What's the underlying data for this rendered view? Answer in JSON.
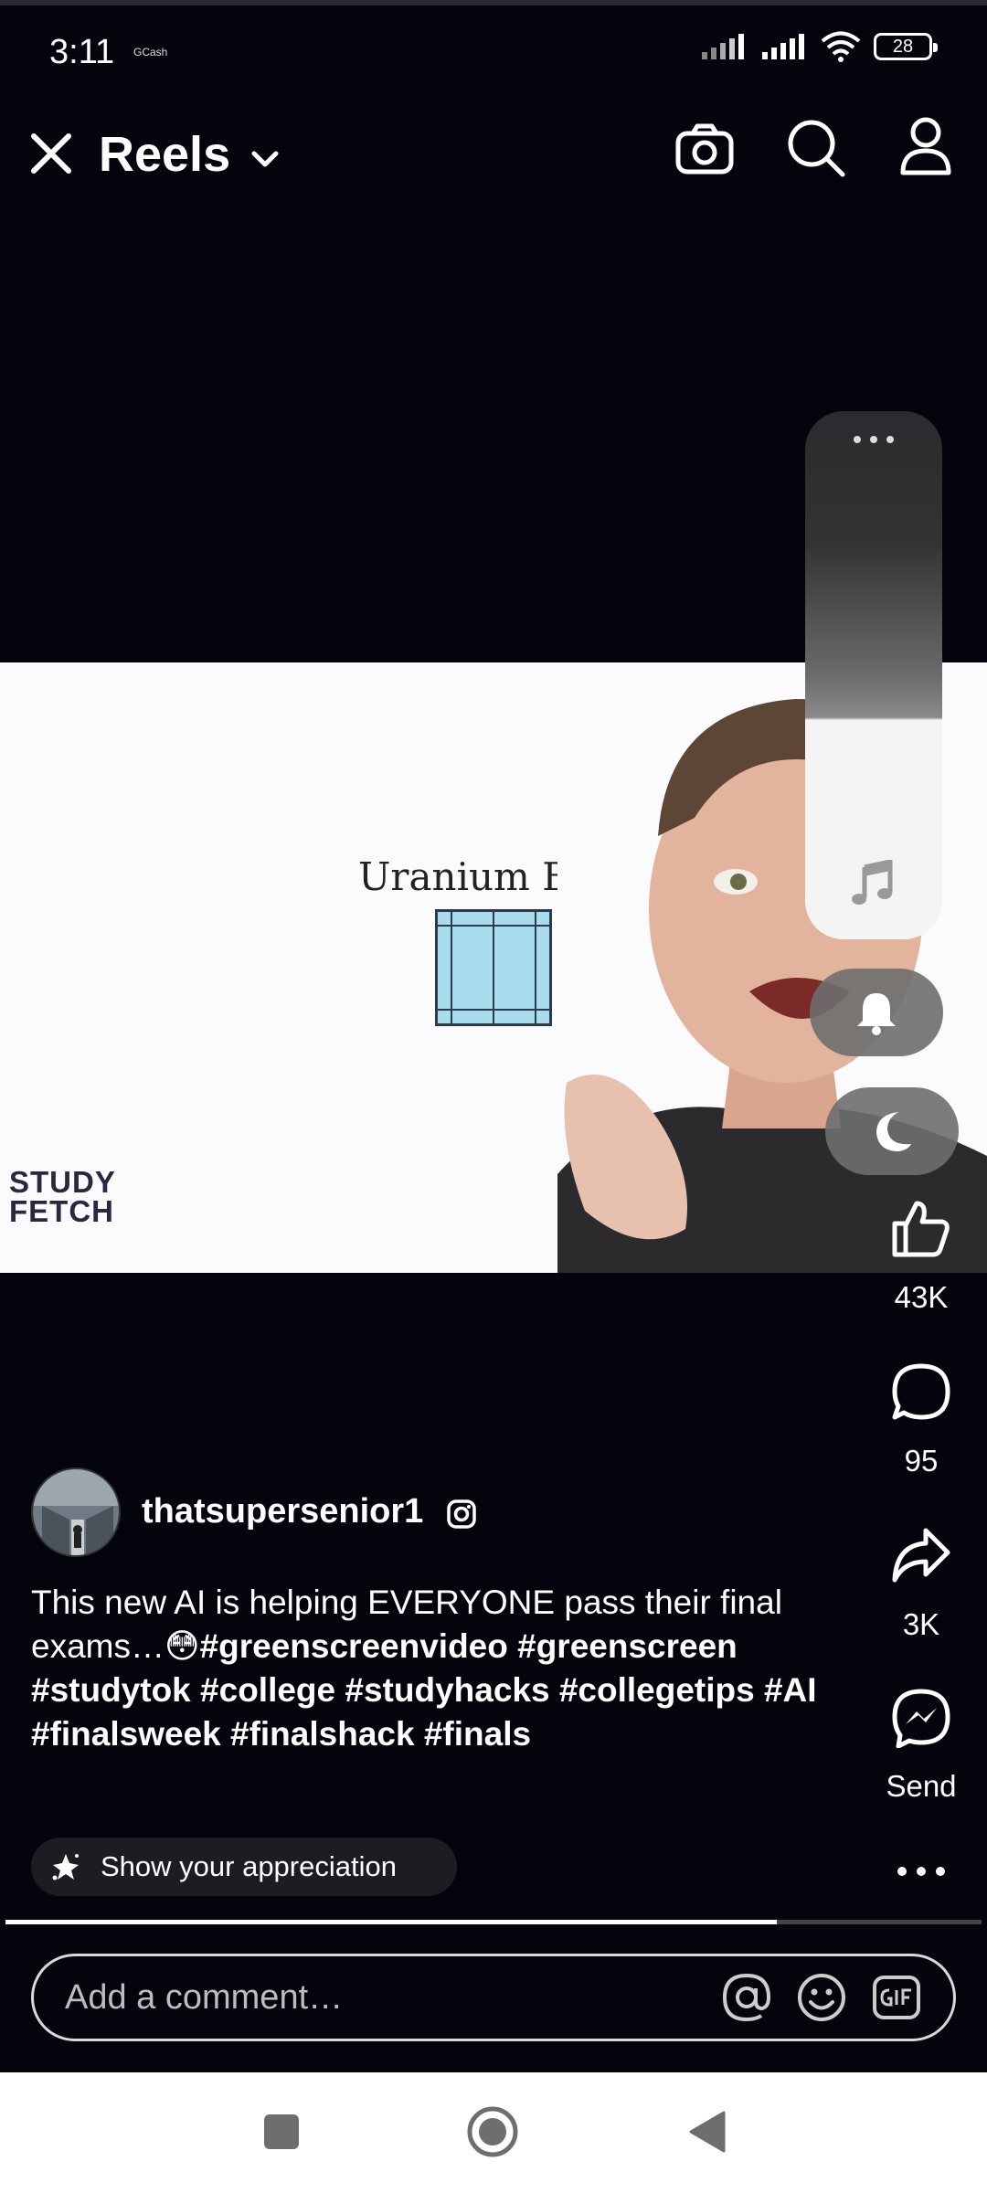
{
  "status_bar": {
    "time": "3:11",
    "carrier": "GCash",
    "battery": "28"
  },
  "header": {
    "title": "Reels"
  },
  "video": {
    "overlay_title": "Uranium Build",
    "brand_line1": "STUDY",
    "brand_line2": "FETCH"
  },
  "actions": {
    "likes": "43K",
    "comments": "95",
    "shares": "3K",
    "send_label": "Send"
  },
  "post": {
    "username": "thatsupersenior1",
    "caption_text": "This new AI is helping EVERYONE pass their final exams…😳",
    "caption_tags": "#greenscreenvideo #greenscreen #studytok #college #studyhacks #collegetips #AI #finalsweek #finalshack #finals",
    "appreciation_label": "Show your appreciation",
    "progress": 0.79
  },
  "comment": {
    "placeholder": "Add a comment…"
  },
  "colors": {
    "background": "#04040c",
    "text": "#ffffff",
    "video_square": "#a9dcec"
  }
}
